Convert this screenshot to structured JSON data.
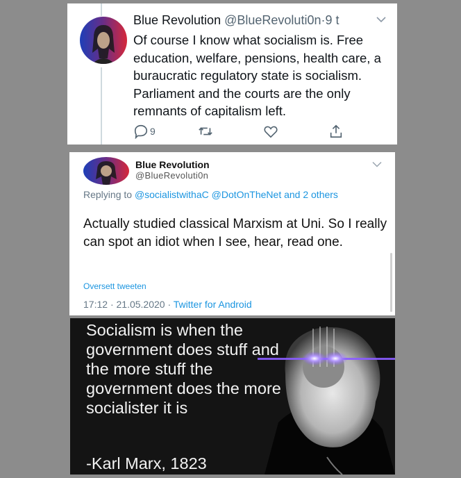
{
  "tweet1": {
    "name": "Blue Revolution",
    "handle": "@BlueRevoluti0n",
    "separator": "·",
    "time": "9 t",
    "text": "Of course I know what socialism is. Free education, welfare, pensions, health care, a buraucratic regulatory state is socialism. Parliament and the courts are the only remnants of capitalism left.",
    "reply_count": "9",
    "icons": [
      "reply-icon",
      "retweet-icon",
      "like-icon",
      "share-icon"
    ]
  },
  "tweet2": {
    "name": "Blue Revolution",
    "handle": "@BlueRevoluti0n",
    "replying_to_prefix": "Replying to",
    "replying_to_users": "@socialistwithaC @DotOnTheNet and 2 others",
    "text": "Actually studied classical Marxism at Uni. So I really can spot an idiot when I see, hear, read one.",
    "translate_label": "Oversett tweeten",
    "time": "17:12",
    "date": "21.05.2020",
    "meta_separator": "·",
    "source": "Twitter for Android"
  },
  "meme": {
    "text": "Socialism is when the government does stuff and the more stuff the government does the more socialister it is",
    "attribution": "-Karl Marx, 1823"
  },
  "colors": {
    "background": "#8c8c8c",
    "link": "#1b95e0",
    "meme_background": "#141414",
    "laser_eyes": "#8a5cff"
  }
}
